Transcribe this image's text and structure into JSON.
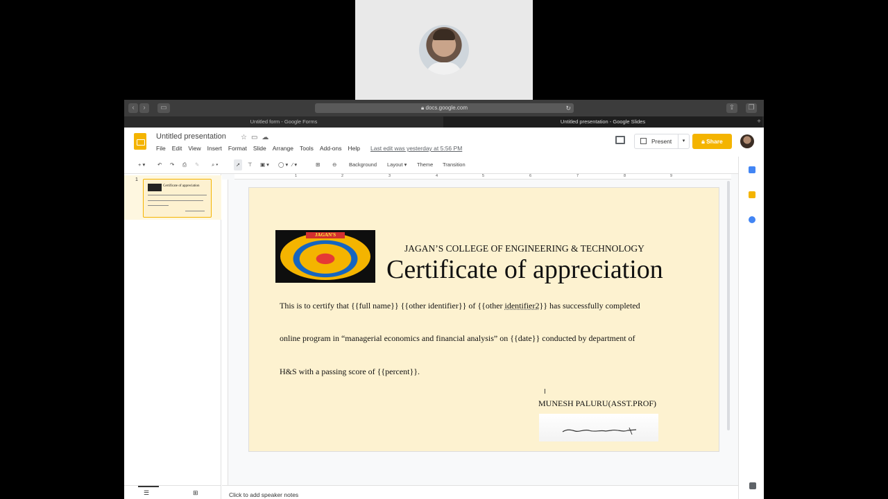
{
  "browser": {
    "url": "docs.google.com",
    "tabs": [
      {
        "label": "Untitled form - Google Forms",
        "active": false
      },
      {
        "label": "Untitled presentation - Google Slides",
        "active": true
      }
    ]
  },
  "app": {
    "doc_title": "Untitled presentation",
    "menu": [
      "File",
      "Edit",
      "View",
      "Insert",
      "Format",
      "Slide",
      "Arrange",
      "Tools",
      "Add-ons",
      "Help"
    ],
    "last_edit": "Last edit was yesterday at 5:56 PM",
    "present_label": "Present",
    "share_label": "Share"
  },
  "toolbar": {
    "background_label": "Background",
    "layout_label": "Layout",
    "theme_label": "Theme",
    "transition_label": "Transition"
  },
  "filmstrip": {
    "slide_number": "1",
    "thumb_title": "Certificate of appreciation"
  },
  "ruler": [
    "1",
    "2",
    "3",
    "4",
    "5",
    "6",
    "7",
    "8",
    "9"
  ],
  "slide": {
    "college_name": "JAGAN’S COLLEGE OF ENGINEERING & TECHNOLOGY",
    "logo_text": "JAGAN'S",
    "title": "Certificate of appreciation",
    "line1_a": "This is to certify that {{full name}}  {{other identifier}} of {{other ",
    "line1_b": "identifier2",
    "line1_c": "}} has successfully completed",
    "line2": "online program in “managerial economics and financial analysis” on {{date}} conducted by department of",
    "line3": "H&S with a passing score of {{percent}}.",
    "signatory": "MUNESH PALURU(ASST.PROF)"
  },
  "notes_placeholder": "Click to add speaker notes",
  "colors": {
    "accent": "#f4b400",
    "slide_bg": "#fdf2d0"
  }
}
